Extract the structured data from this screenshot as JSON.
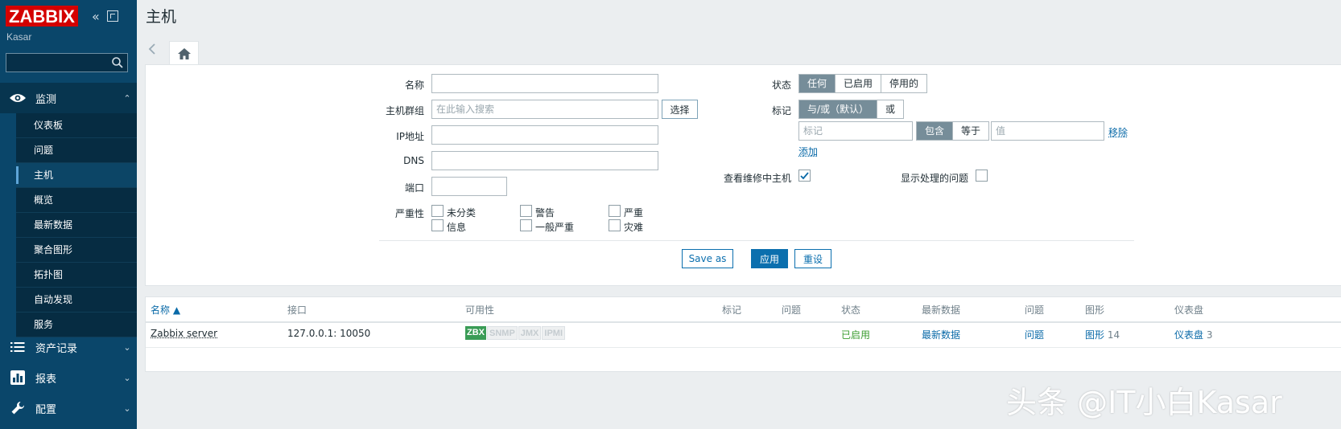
{
  "sidebar": {
    "logo": "ZABBIX",
    "server_name": "Kasar",
    "search_placeholder": "",
    "monitoring": {
      "label": "监测",
      "items": [
        {
          "label": "仪表板"
        },
        {
          "label": "问题"
        },
        {
          "label": "主机",
          "active": true
        },
        {
          "label": "概览"
        },
        {
          "label": "最新数据"
        },
        {
          "label": "聚合图形"
        },
        {
          "label": "拓扑图"
        },
        {
          "label": "自动发现"
        },
        {
          "label": "服务"
        }
      ]
    },
    "inventory_label": "资产记录",
    "reports_label": "报表",
    "config_label": "配置"
  },
  "header": {
    "title": "主机"
  },
  "filter": {
    "name_label": "名称",
    "name_value": "",
    "hostgroup_label": "主机群组",
    "hostgroup_placeholder": "在此输入搜索",
    "select_button": "选择",
    "ip_label": "IP地址",
    "ip_value": "",
    "dns_label": "DNS",
    "dns_value": "",
    "port_label": "端口",
    "port_value": "",
    "severity_label": "严重性",
    "severities": [
      "未分类",
      "警告",
      "严重",
      "信息",
      "一般严重",
      "灾难"
    ],
    "status_label": "状态",
    "status_options": [
      "任何",
      "已启用",
      "停用的"
    ],
    "status_selected": "任何",
    "tags_label": "标记",
    "tag_logic_options": [
      "与/或（默认）",
      "或"
    ],
    "tag_logic_selected": "与/或（默认）",
    "tag_placeholder": "标记",
    "tag_operator_options": [
      "包含",
      "等于"
    ],
    "tag_operator_selected": "包含",
    "value_placeholder": "值",
    "remove_link": "移除",
    "add_link": "添加",
    "maintenance_label": "查看维修中主机",
    "maintenance_checked": true,
    "suppressed_label": "显示处理的问题",
    "suppressed_checked": false,
    "save_as_button": "Save as",
    "apply_button": "应用",
    "reset_button": "重设"
  },
  "table": {
    "columns": [
      "名称 ▲",
      "接口",
      "可用性",
      "标记",
      "问题",
      "状态",
      "最新数据",
      "问题",
      "图形",
      "仪表盘"
    ],
    "rows": [
      {
        "name": "Zabbix server",
        "interface": "127.0.0.1: 10050",
        "availability": [
          "ZBX",
          "SNMP",
          "JMX",
          "IPMI"
        ],
        "availability_active": [
          "ZBX"
        ],
        "tags": "",
        "problems": "",
        "status": "已启用",
        "latest_data": "最新数据",
        "problems_link": "问题",
        "graphs": "图形",
        "graphs_count": "14",
        "dashboards": "仪表盘",
        "dashboards_count": "3"
      }
    ]
  },
  "watermark": "头条 @IT小白Kasar",
  "colors": {
    "sidebar_bg": "#0a466a",
    "logo_red": "#d40000",
    "accent_blue": "#0b6fae",
    "status_green": "#3a9c2f",
    "zbx_green": "#3a9c56"
  }
}
